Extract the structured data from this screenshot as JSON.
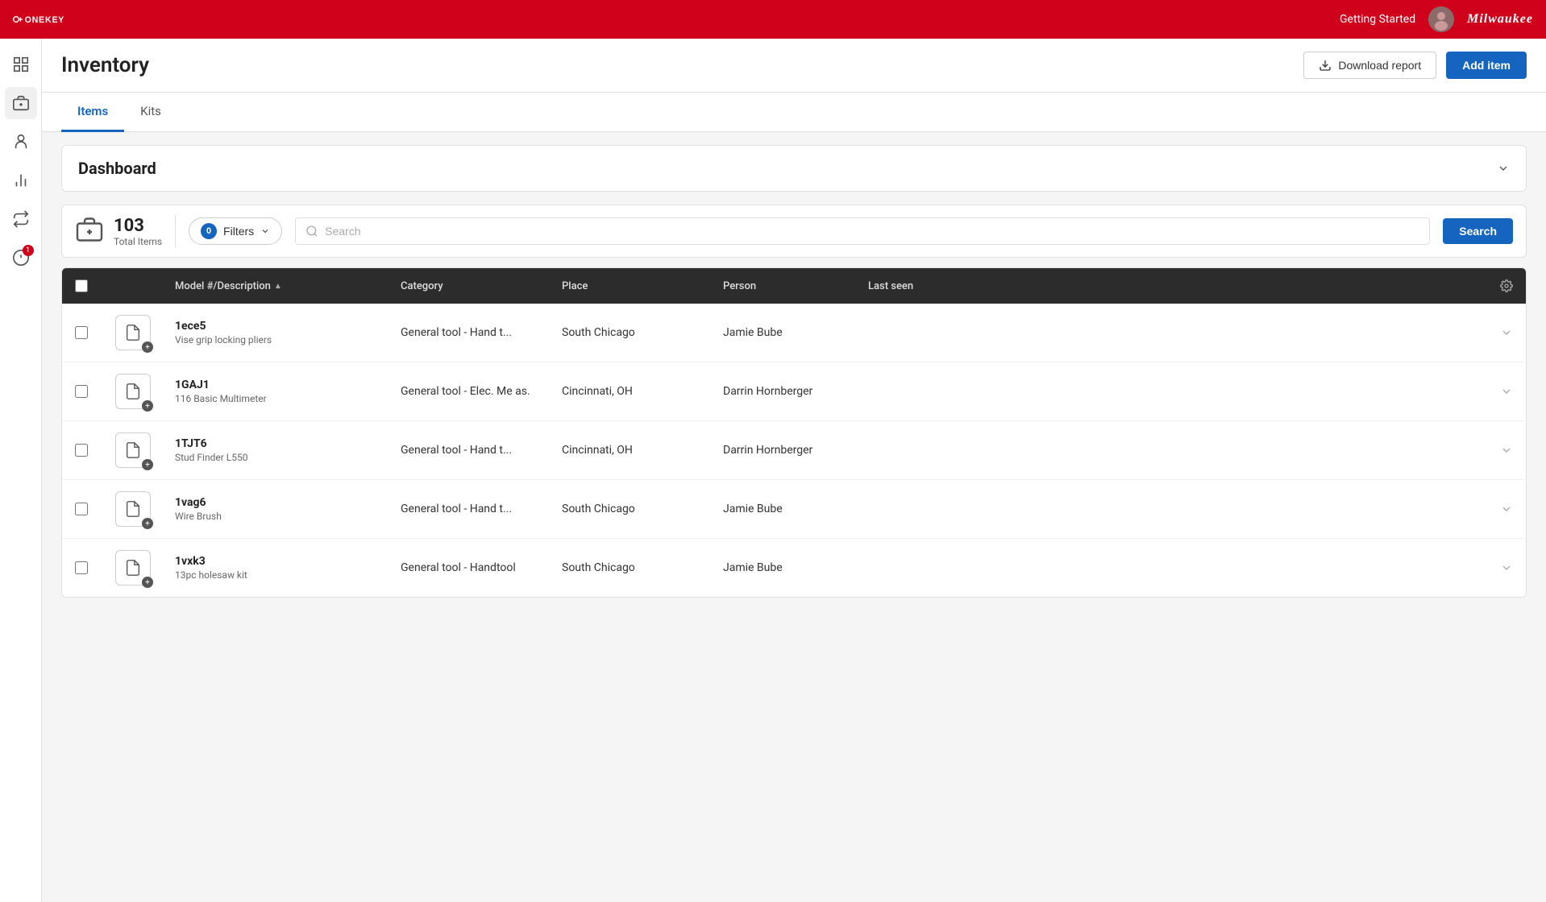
{
  "app": {
    "name": "ONE-KEY",
    "getting_started": "Getting Started",
    "milwaukee_label": "Milwaukee"
  },
  "page": {
    "title": "Inventory",
    "download_report": "Download report",
    "add_item": "Add item"
  },
  "tabs": [
    {
      "id": "items",
      "label": "Items",
      "active": true
    },
    {
      "id": "kits",
      "label": "Kits",
      "active": false
    }
  ],
  "dashboard": {
    "title": "Dashboard"
  },
  "filter_bar": {
    "total_count": "103",
    "total_label": "Total Items",
    "filter_badge": "0",
    "filter_label": "Filters",
    "search_placeholder": "Search",
    "search_button": "Search"
  },
  "table": {
    "columns": [
      {
        "id": "checkbox",
        "label": ""
      },
      {
        "id": "icon",
        "label": ""
      },
      {
        "id": "model",
        "label": "Model #/Description",
        "sortable": true
      },
      {
        "id": "category",
        "label": "Category"
      },
      {
        "id": "place",
        "label": "Place"
      },
      {
        "id": "person",
        "label": "Person"
      },
      {
        "id": "last_seen",
        "label": "Last seen"
      },
      {
        "id": "settings",
        "label": ""
      }
    ],
    "rows": [
      {
        "tool_number": "1ece5",
        "description": "Vise grip locking pliers",
        "category": "General tool - Hand t...",
        "place": "South Chicago",
        "person": "Jamie Bube",
        "last_seen": ""
      },
      {
        "tool_number": "1GAJ1",
        "description": "116 Basic Multimeter",
        "category": "General tool - Elec. Me as.",
        "place": "Cincinnati, OH",
        "person": "Darrin Hornberger",
        "last_seen": ""
      },
      {
        "tool_number": "1TJT6",
        "description": "Stud Finder L550",
        "category": "General tool - Hand t...",
        "place": "Cincinnati, OH",
        "person": "Darrin Hornberger",
        "last_seen": ""
      },
      {
        "tool_number": "1vag6",
        "description": "Wire Brush",
        "category": "General tool - Hand t...",
        "place": "South Chicago",
        "person": "Jamie Bube",
        "last_seen": ""
      },
      {
        "tool_number": "1vxk3",
        "description": "13pc holesaw kit",
        "category": "General tool - Handtool",
        "place": "South Chicago",
        "person": "Jamie Bube",
        "last_seen": ""
      }
    ]
  },
  "sidebar": {
    "items": [
      {
        "id": "dashboard",
        "icon": "grid-icon"
      },
      {
        "id": "tools",
        "icon": "tools-icon"
      },
      {
        "id": "person",
        "icon": "person-icon"
      },
      {
        "id": "chart",
        "icon": "chart-icon"
      },
      {
        "id": "transfer",
        "icon": "transfer-icon"
      },
      {
        "id": "alert",
        "icon": "alert-icon",
        "badge": "1"
      }
    ]
  }
}
